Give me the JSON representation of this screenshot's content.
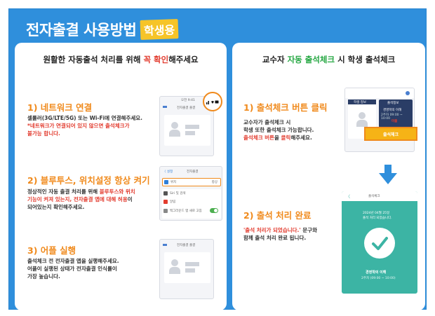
{
  "header": {
    "title": "전자출결 사용방법",
    "badge": "학생용"
  },
  "left_panel": {
    "heading_prefix": "원활한 자동출석 처리를 위해 ",
    "heading_highlight": "꼭 확인",
    "heading_suffix": "해주세요",
    "sections": [
      {
        "title": "1) 네트워크 연결",
        "line1": "셀룰러(3G/LTE/5G) 또는 Wi-Fi에 연결해주세요.",
        "line2_red": "*네트워크가 연결되어 있지 않으면 출석체크가",
        "line3_red": "불가능 합니다."
      },
      {
        "title": "2) 블루투스, 위치설정 항상 켜기",
        "line1_a": "정상적인 자동 출결 처리를 위해 ",
        "line1_red": "블루투스와 위치",
        "line2_red": "기능이 켜져 있는지, 전자출결 앱에 대해 허용",
        "line2_b": "이",
        "line3": "되어있는지 확인해주세요."
      },
      {
        "title": "3) 어플 실행",
        "line1": "출석체크 전 전자출결 앱을 실행해주세요.",
        "line2": "어플이 실행된 상태가 전자출결 인식률이",
        "line3": "가장 높습니다."
      }
    ],
    "phone1": {
      "top": "오전 9:41",
      "header": "전자출결 출결"
    },
    "phone2": {
      "back": "〈 설정",
      "title": "전자출결",
      "row1": "위치",
      "row1_value": "항상",
      "row2": "Siri 및 검색",
      "row3": "알림",
      "row4": "백그라운드 앱 새로 고침"
    },
    "phone3": {
      "header": "전자출결 출결"
    }
  },
  "right_panel": {
    "heading_prefix": "교수자 ",
    "heading_highlight": "자동 출석체크",
    "heading_suffix": " 시 학생 출석체크",
    "sections": [
      {
        "title": "1) 출석체크 버튼 클릭",
        "line1": "교수자가 출석체크 시",
        "line2": "학생 또한 출석체크 가능합니다.",
        "line3_red": "출석체크 버튼",
        "line3_mid": "을 ",
        "line3_red2": "클릭",
        "line3_end": "해주세요."
      },
      {
        "title": "2) 출석 처리 완료",
        "line1_red": "'출석 처리가 되었습니다.'",
        "line1_end": " 문구와",
        "line2": "함께 출석 처리 완료 됩니다."
      }
    ],
    "phone1": {
      "col1": "학생 정보",
      "col2": "출석정보",
      "course": "경영학의 이해",
      "time": "2주차 09:00 ~ 10:00",
      "status": "미출",
      "button": "출석체크"
    },
    "phone2": {
      "header": "출석체크",
      "msg1": "2024년 04월 25일",
      "msg2": "출석 처리 되었습니다.",
      "course": "경영학의 이해",
      "time": "2주차 (09:00 ~ 10:00)"
    }
  },
  "colors": {
    "brand": "#2f8fdc",
    "accent_orange": "#f08a1c",
    "badge_yellow": "#f6c428",
    "highlight_red": "#e23b2e",
    "highlight_green": "#27a844",
    "success_teal": "#3cb4a4"
  }
}
